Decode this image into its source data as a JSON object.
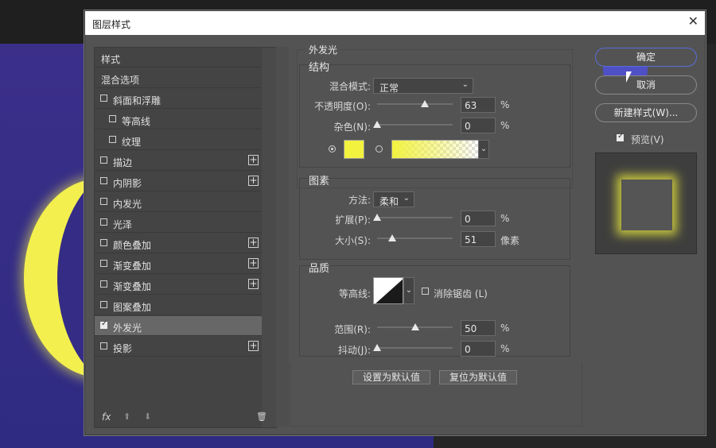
{
  "window": {
    "title": "图层样式",
    "close_glyph": "✕"
  },
  "styles_panel": {
    "items": [
      {
        "label": "样式",
        "checkbox": false,
        "checked": false,
        "plus": false,
        "indent": false,
        "selected": false
      },
      {
        "label": "混合选项",
        "checkbox": false,
        "checked": false,
        "plus": false,
        "indent": false,
        "selected": false
      },
      {
        "label": "斜面和浮雕",
        "checkbox": true,
        "checked": false,
        "plus": false,
        "indent": false,
        "selected": false
      },
      {
        "label": "等高线",
        "checkbox": true,
        "checked": false,
        "plus": false,
        "indent": true,
        "selected": false
      },
      {
        "label": "纹理",
        "checkbox": true,
        "checked": false,
        "plus": false,
        "indent": true,
        "selected": false
      },
      {
        "label": "描边",
        "checkbox": true,
        "checked": false,
        "plus": true,
        "indent": false,
        "selected": false
      },
      {
        "label": "内阴影",
        "checkbox": true,
        "checked": false,
        "plus": true,
        "indent": false,
        "selected": false
      },
      {
        "label": "内发光",
        "checkbox": true,
        "checked": false,
        "plus": false,
        "indent": false,
        "selected": false
      },
      {
        "label": "光泽",
        "checkbox": true,
        "checked": false,
        "plus": false,
        "indent": false,
        "selected": false
      },
      {
        "label": "颜色叠加",
        "checkbox": true,
        "checked": false,
        "plus": true,
        "indent": false,
        "selected": false
      },
      {
        "label": "渐变叠加",
        "checkbox": true,
        "checked": false,
        "plus": true,
        "indent": false,
        "selected": false
      },
      {
        "label": "渐变叠加",
        "checkbox": true,
        "checked": false,
        "plus": true,
        "indent": false,
        "selected": false
      },
      {
        "label": "图案叠加",
        "checkbox": true,
        "checked": false,
        "plus": false,
        "indent": false,
        "selected": false
      },
      {
        "label": "外发光",
        "checkbox": true,
        "checked": true,
        "plus": false,
        "indent": false,
        "selected": true
      },
      {
        "label": "投影",
        "checkbox": true,
        "checked": false,
        "plus": true,
        "indent": false,
        "selected": false
      }
    ],
    "footer": {
      "fx": "fx",
      "up": "⬆",
      "down": "⬇",
      "trash": "🗑"
    }
  },
  "outer_glow": {
    "title": "外发光",
    "structure": {
      "title": "结构",
      "blend_mode_label": "混合模式:",
      "blend_mode_value": "正常",
      "opacity_label": "不透明度(O):",
      "opacity_value": "63",
      "opacity_fraction": 0.63,
      "noise_label": "杂色(N):",
      "noise_value": "0",
      "noise_fraction": 0.0,
      "percent": "%"
    },
    "elements": {
      "title": "图素",
      "technique_label": "方法:",
      "technique_value": "柔和",
      "spread_label": "扩展(P):",
      "spread_value": "0",
      "spread_fraction": 0.0,
      "size_label": "大小(S):",
      "size_value": "51",
      "size_fraction": 0.2,
      "px_unit": "像素",
      "percent": "%"
    },
    "quality": {
      "title": "品质",
      "contour_label": "等高线:",
      "antialias_label": "消除锯齿 (L)",
      "range_label": "范围(R):",
      "range_value": "50",
      "range_fraction": 0.5,
      "jitter_label": "抖动(J):",
      "jitter_value": "0",
      "jitter_fraction": 0.0,
      "percent": "%"
    },
    "set_default_label": "设置为默认值",
    "reset_default_label": "复位为默认值",
    "glow_color": "#f2f23f"
  },
  "actions": {
    "ok": "确定",
    "cancel": "取消",
    "new_style": "新建样式(W)...",
    "preview_label": "预览(V)",
    "preview_checked": true
  }
}
